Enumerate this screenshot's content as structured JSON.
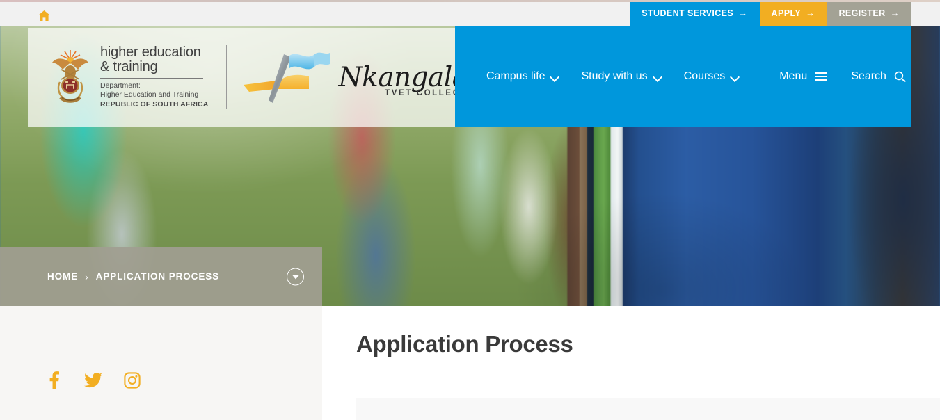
{
  "utility_bar": {
    "home_icon": "home-icon",
    "buttons": [
      {
        "label": "STUDENT SERVICES",
        "arrow": "→",
        "color": "#0097dc",
        "name": "student-services"
      },
      {
        "label": "APPLY",
        "arrow": "→",
        "color": "#f2ae22",
        "name": "apply"
      },
      {
        "label": "REGISTER",
        "arrow": "→",
        "color": "#a3a295",
        "name": "register"
      }
    ]
  },
  "logo": {
    "dhet": {
      "line1": "higher education",
      "line2": "& training",
      "department_label": "Department:",
      "department_name": "Higher Education and Training",
      "country": "REPUBLIC OF SOUTH AFRICA",
      "emblem": "coat-of-arms-icon"
    },
    "college": {
      "name": "Nkangala",
      "tagline": "TVET COLLEGE",
      "mark": "flag-book-logo-icon"
    }
  },
  "nav": {
    "items": [
      {
        "label": "Campus life",
        "has_dropdown": true
      },
      {
        "label": "Study with us",
        "has_dropdown": true
      },
      {
        "label": "Courses",
        "has_dropdown": true
      }
    ],
    "menu_label": "Menu",
    "menu_icon": "hamburger-icon",
    "search_label": "Search",
    "search_icon": "search-icon",
    "background_color": "#0097dc"
  },
  "breadcrumb": {
    "items": [
      {
        "label": "HOME",
        "link": true
      },
      {
        "label": "APPLICATION PROCESS",
        "link": false
      }
    ],
    "separator": "›",
    "scroll_icon": "chevron-down-circle-icon"
  },
  "main": {
    "page_title": "Application Process"
  },
  "sidebar": {
    "social": [
      {
        "name": "facebook-icon",
        "label": "Facebook"
      },
      {
        "name": "twitter-icon",
        "label": "Twitter"
      },
      {
        "name": "instagram-icon",
        "label": "Instagram"
      }
    ],
    "accent_color": "#f2ae22"
  }
}
